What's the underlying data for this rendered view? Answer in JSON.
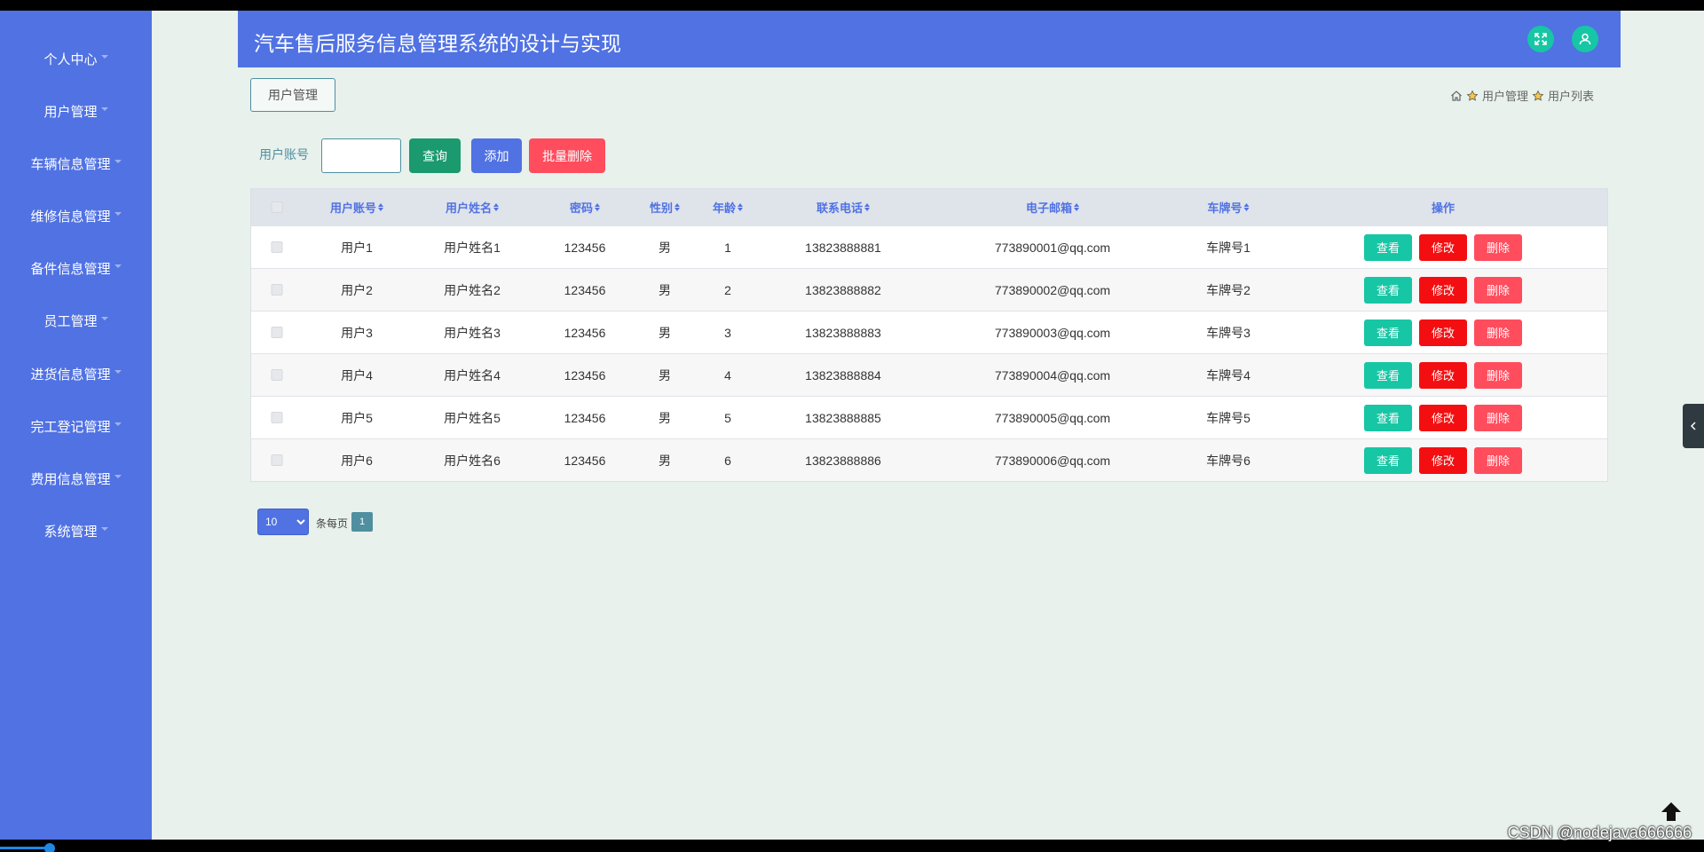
{
  "app": {
    "title": "汽车售后服务信息管理系统的设计与实现"
  },
  "sidebar": {
    "items": [
      {
        "label": "个人中心"
      },
      {
        "label": "用户管理"
      },
      {
        "label": "车辆信息管理"
      },
      {
        "label": "维修信息管理"
      },
      {
        "label": "备件信息管理"
      },
      {
        "label": "员工管理"
      },
      {
        "label": "进货信息管理"
      },
      {
        "label": "完工登记管理"
      },
      {
        "label": "费用信息管理"
      },
      {
        "label": "系统管理"
      }
    ]
  },
  "header": {
    "fullscreen_icon": "fullscreen-icon",
    "user_icon": "user-icon"
  },
  "tab": {
    "label": "用户管理"
  },
  "breadcrumb": {
    "home_icon": "home-icon",
    "items": [
      {
        "label": "用户管理"
      },
      {
        "label": "用户列表"
      }
    ]
  },
  "search": {
    "label": "用户账号",
    "value": "",
    "placeholder": "",
    "query_button": "查询",
    "add_button": "添加",
    "batch_delete_button": "批量删除"
  },
  "table": {
    "columns": [
      "用户账号",
      "用户姓名",
      "密码",
      "性别",
      "年龄",
      "联系电话",
      "电子邮箱",
      "车牌号",
      "操作"
    ],
    "rows": [
      {
        "account": "用户1",
        "name": "用户姓名1",
        "password": "123456",
        "gender": "男",
        "age": "1",
        "phone": "13823888881",
        "email": "773890001@qq.com",
        "plate": "车牌号1"
      },
      {
        "account": "用户2",
        "name": "用户姓名2",
        "password": "123456",
        "gender": "男",
        "age": "2",
        "phone": "13823888882",
        "email": "773890002@qq.com",
        "plate": "车牌号2"
      },
      {
        "account": "用户3",
        "name": "用户姓名3",
        "password": "123456",
        "gender": "男",
        "age": "3",
        "phone": "13823888883",
        "email": "773890003@qq.com",
        "plate": "车牌号3"
      },
      {
        "account": "用户4",
        "name": "用户姓名4",
        "password": "123456",
        "gender": "男",
        "age": "4",
        "phone": "13823888884",
        "email": "773890004@qq.com",
        "plate": "车牌号4"
      },
      {
        "account": "用户5",
        "name": "用户姓名5",
        "password": "123456",
        "gender": "男",
        "age": "5",
        "phone": "13823888885",
        "email": "773890005@qq.com",
        "plate": "车牌号5"
      },
      {
        "account": "用户6",
        "name": "用户姓名6",
        "password": "123456",
        "gender": "男",
        "age": "6",
        "phone": "13823888886",
        "email": "773890006@qq.com",
        "plate": "车牌号6"
      }
    ],
    "actions": {
      "view": "查看",
      "edit": "修改",
      "delete": "删除"
    }
  },
  "pagination": {
    "page_size": "10",
    "per_page_label": "条每页",
    "current_page": "1"
  },
  "watermark": "CSDN @nodejava666666",
  "colors": {
    "primary": "#5072e3",
    "success": "#17c6a4",
    "danger": "#f30f11",
    "danger_soft": "#ff4d5e",
    "query": "#1a9a6e",
    "background": "#e8f1ec"
  }
}
